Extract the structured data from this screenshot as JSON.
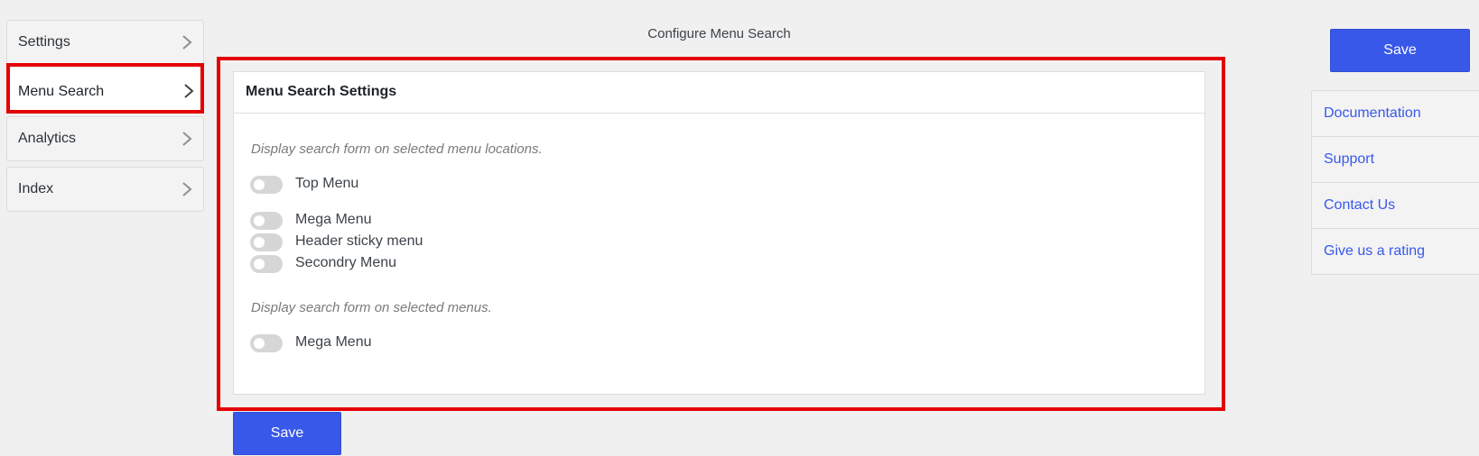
{
  "nav": {
    "items": [
      {
        "label": "Settings"
      },
      {
        "label": "Menu Search"
      },
      {
        "label": "Analytics"
      },
      {
        "label": "Index"
      }
    ]
  },
  "page": {
    "title": "Configure Menu Search"
  },
  "card": {
    "title": "Menu Search Settings",
    "hint_locations": "Display search form on selected menu locations.",
    "locations": [
      {
        "label": "Top Menu",
        "enabled": false
      },
      {
        "label": "Mega Menu",
        "enabled": false
      },
      {
        "label": "Header sticky menu",
        "enabled": false
      },
      {
        "label": "Secondry Menu",
        "enabled": false
      }
    ],
    "hint_menus": "Display search form on selected menus.",
    "menus": [
      {
        "label": "Mega Menu",
        "enabled": false
      }
    ]
  },
  "actions": {
    "save_top": "Save",
    "save_bottom": "Save"
  },
  "links": [
    {
      "label": "Documentation"
    },
    {
      "label": "Support"
    },
    {
      "label": "Contact Us"
    },
    {
      "label": "Give us a rating"
    }
  ],
  "colors": {
    "accent": "#3858e9",
    "highlight": "#e40000",
    "toggle_off": "#d6d6d6"
  }
}
